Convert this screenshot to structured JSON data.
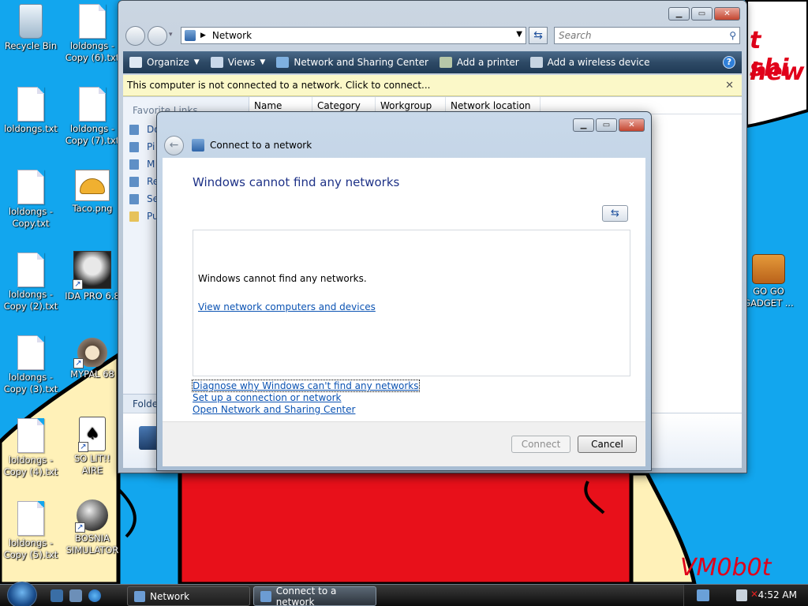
{
  "desktop": {
    "icons": [
      {
        "label": "Recycle Bin",
        "icon": "recycle-bin-icon"
      },
      {
        "label": "loldongs - Copy (6).txt",
        "icon": "text-file-icon"
      },
      {
        "label": "loldongs.txt",
        "icon": "text-file-icon"
      },
      {
        "label": "loldongs - Copy (7).txt",
        "icon": "text-file-icon"
      },
      {
        "label": "loldongs - Copy.txt",
        "icon": "text-file-icon"
      },
      {
        "label": "Taco.png",
        "icon": "taco-image-icon"
      },
      {
        "label": "loldongs - Copy (2).txt",
        "icon": "text-file-icon"
      },
      {
        "label": "IDA PRO 6.8",
        "icon": "ida-pro-shortcut-icon"
      },
      {
        "label": "loldongs - Copy (3).txt",
        "icon": "text-file-icon"
      },
      {
        "label": "MYPAL 68",
        "icon": "mypal-raccoon-icon"
      },
      {
        "label": "loldongs - Copy (4).txt",
        "icon": "text-file-icon"
      },
      {
        "label": "SO LIT!! AIRE",
        "icon": "solitaire-cards-icon"
      },
      {
        "label": "loldongs - Copy (5).txt",
        "icon": "text-file-icon"
      },
      {
        "label": "BOSNIA SIMULATOR",
        "icon": "mine-icon"
      },
      {
        "label": "GO GO GADGET ...",
        "icon": "briefcase-icon"
      }
    ],
    "wallpaper_text": "VM0b0t",
    "wallpaper_text_top": "t shi",
    "wallpaper_text_top2": "hew"
  },
  "network_window": {
    "address": "Network",
    "search_placeholder": "Search",
    "toolbar": {
      "organize": "Organize",
      "views": "Views",
      "sharing_center": "Network and Sharing Center",
      "add_printer": "Add a printer",
      "add_wireless": "Add a wireless device",
      "help": "?"
    },
    "infobar": "This computer is not connected to a network. Click to connect...",
    "favorite_links_header": "Favorite Links",
    "favorite_links": [
      "Do",
      "Pi",
      "M",
      "Re",
      "Se",
      "Pu"
    ],
    "columns": [
      "Name",
      "Category",
      "Workgroup",
      "Network location"
    ],
    "folders_label": "Folder"
  },
  "dialog": {
    "title": "Connect to a network",
    "heading": "Windows cannot find any networks",
    "message": "Windows cannot find any networks.",
    "view_link": "View network computers and devices",
    "diagnose_link": "Diagnose why Windows can't find any networks",
    "setup_link": "Set up a connection or network",
    "open_center_link": "Open Network and Sharing Center",
    "connect_button": "Connect",
    "cancel_button": "Cancel"
  },
  "taskbar": {
    "tasks": [
      {
        "label": "Network",
        "active": false
      },
      {
        "label": "Connect to a network",
        "active": true
      }
    ],
    "clock": "4:52 AM"
  }
}
